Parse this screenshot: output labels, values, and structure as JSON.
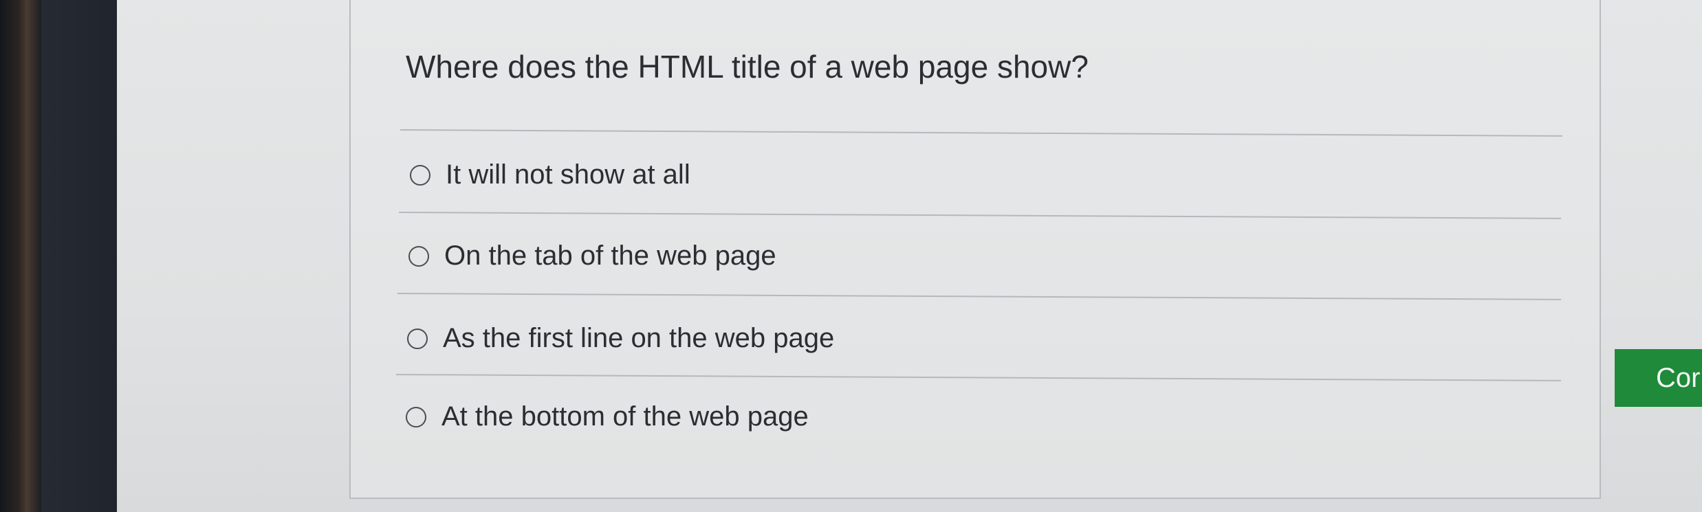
{
  "quiz": {
    "question": "Where does the HTML title of a web page show?",
    "options": [
      {
        "label": "It will not show at all"
      },
      {
        "label": "On the tab of the web page"
      },
      {
        "label": "As the first line on the web page"
      },
      {
        "label": "At the bottom of the web page"
      }
    ]
  },
  "actions": {
    "continue_label": "Cor"
  },
  "colors": {
    "continue_button": "#1e8a3a",
    "text": "#2b2e31"
  }
}
